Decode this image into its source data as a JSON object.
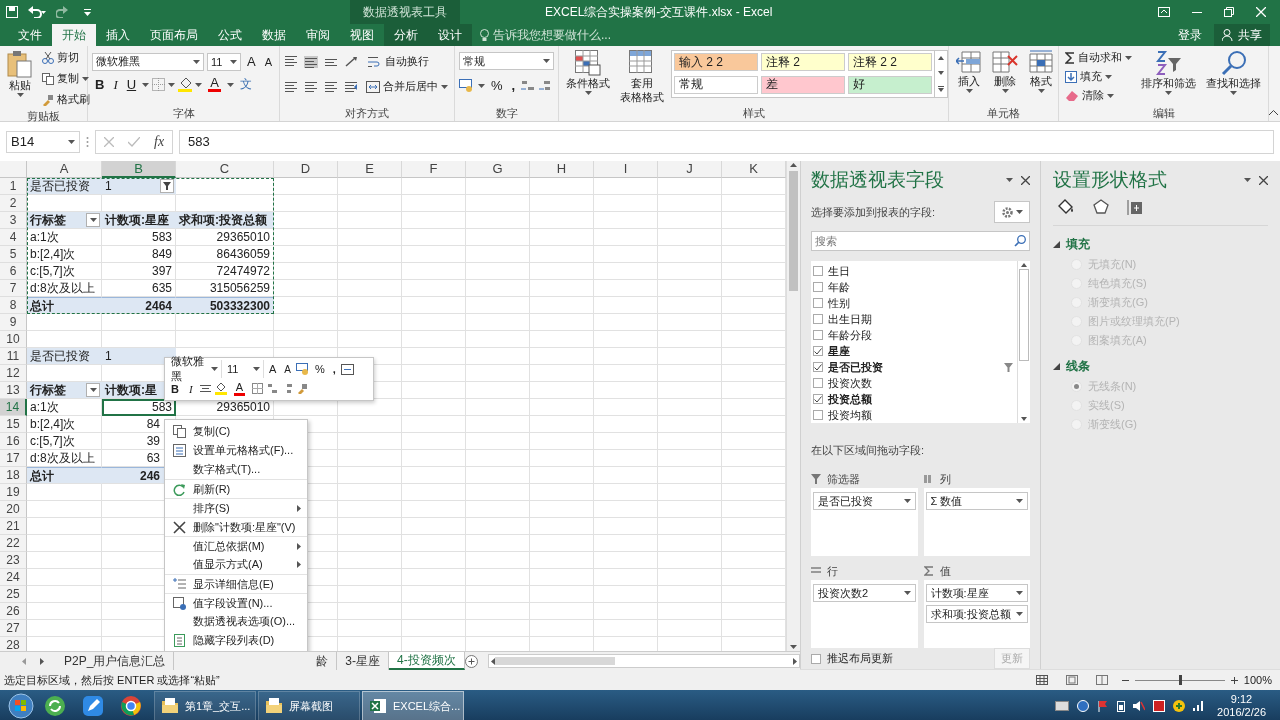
{
  "title_bar": {
    "title": "EXCEL综合实操案例-交互课件.xlsx - Excel",
    "context_group": "数据透视表工具"
  },
  "tabs": [
    {
      "label": "文件",
      "selected": false,
      "contextual": false
    },
    {
      "label": "开始",
      "selected": true,
      "contextual": false
    },
    {
      "label": "插入",
      "selected": false,
      "contextual": false
    },
    {
      "label": "页面布局",
      "selected": false,
      "contextual": false
    },
    {
      "label": "公式",
      "selected": false,
      "contextual": false
    },
    {
      "label": "数据",
      "selected": false,
      "contextual": false
    },
    {
      "label": "审阅",
      "selected": false,
      "contextual": false
    },
    {
      "label": "视图",
      "selected": false,
      "contextual": false
    },
    {
      "label": "分析",
      "selected": false,
      "contextual": true
    },
    {
      "label": "设计",
      "selected": false,
      "contextual": true
    }
  ],
  "tell_me": {
    "placeholder": "告诉我您想要做什么..."
  },
  "account": {
    "sign_in": "登录",
    "share": "共享"
  },
  "ribbon": {
    "clipboard": {
      "paste": "粘贴",
      "cut": "剪切",
      "copy": "复制",
      "format_painter": "格式刷",
      "label": "剪贴板"
    },
    "font": {
      "name": "微软雅黑",
      "size": "11",
      "grow": "A",
      "shrink": "A",
      "bold": "B",
      "italic": "I",
      "underline": "U",
      "font_color_glyph": "A",
      "phonetic": "文",
      "label": "字体"
    },
    "alignment": {
      "wrap": "自动换行",
      "merge": "合并后居中",
      "label": "对齐方式"
    },
    "number": {
      "format": "常规",
      "percent": "%",
      "comma": ",",
      "label": "数字"
    },
    "styles": {
      "conditional": "条件格式",
      "table_lines": [
        "套用",
        "表格格式"
      ],
      "label": "样式",
      "gallery": [
        {
          "label": "输入 2 2",
          "color": "#f9c89b"
        },
        {
          "label": "注释 2",
          "color": "#ffffcc"
        },
        {
          "label": "注释 2 2",
          "color": "#ffffcc"
        },
        {
          "label": "常规",
          "color": "#ffffff"
        },
        {
          "label": "差",
          "color": "#ffc7ce"
        },
        {
          "label": "好",
          "color": "#c6efce"
        }
      ]
    },
    "cells": {
      "insert": "插入",
      "delete": "删除",
      "format": "格式",
      "label": "单元格"
    },
    "editing": {
      "autosum": "自动求和",
      "fill": "填充",
      "clear": "清除",
      "sort": "排序和筛选",
      "find": "查找和选择",
      "label": "编辑"
    }
  },
  "formula_bar": {
    "name_box": "B14",
    "function_label": "fx",
    "value": "583"
  },
  "grid": {
    "columns": [
      {
        "label": "A",
        "selected": false
      },
      {
        "label": "B",
        "selected": true
      },
      {
        "label": "C",
        "selected": false
      },
      {
        "label": "D",
        "selected": false
      },
      {
        "label": "E",
        "selected": false
      },
      {
        "label": "F",
        "selected": false
      },
      {
        "label": "G",
        "selected": false
      },
      {
        "label": "H",
        "selected": false
      },
      {
        "label": "I",
        "selected": false
      },
      {
        "label": "J",
        "selected": false
      },
      {
        "label": "K",
        "selected": false
      }
    ],
    "rows": [
      {
        "number": "1",
        "selected": false,
        "kind": "filter",
        "covered": false,
        "cells": [
          "是否已投资",
          "1"
        ]
      },
      {
        "number": "2",
        "selected": false,
        "kind": "empty",
        "cells": []
      },
      {
        "number": "3",
        "selected": false,
        "kind": "header",
        "cells": [
          "行标签",
          "计数项:星座",
          "求和项:投资总额"
        ]
      },
      {
        "number": "4",
        "selected": false,
        "kind": "data",
        "covered": false,
        "cells": [
          "a:1次",
          "583",
          "29365010"
        ]
      },
      {
        "number": "5",
        "selected": false,
        "kind": "data",
        "covered": false,
        "cells": [
          "b:[2,4]次",
          "849",
          "86436059"
        ]
      },
      {
        "number": "6",
        "selected": false,
        "kind": "data",
        "covered": false,
        "cells": [
          "c:[5,7]次",
          "397",
          "72474972"
        ]
      },
      {
        "number": "7",
        "selected": false,
        "kind": "data",
        "covered": false,
        "cells": [
          "d:8次及以上",
          "635",
          "315056259"
        ]
      },
      {
        "number": "8",
        "selected": false,
        "kind": "total",
        "covered": false,
        "cells": [
          "总计",
          "2464",
          "503332300"
        ]
      },
      {
        "number": "9",
        "selected": false,
        "kind": "empty",
        "cells": []
      },
      {
        "number": "10",
        "selected": false,
        "kind": "empty",
        "cells": []
      },
      {
        "number": "11",
        "selected": false,
        "kind": "filter",
        "covered": true,
        "cells": [
          "是否已投资",
          "1"
        ]
      },
      {
        "number": "12",
        "selected": false,
        "kind": "empty",
        "cells": []
      },
      {
        "number": "13",
        "selected": false,
        "kind": "header",
        "cells": [
          "行标签",
          "计数项:星"
        ]
      },
      {
        "number": "14",
        "selected": true,
        "kind": "data",
        "covered": false,
        "cells": [
          "a:1次",
          "583",
          "29365010"
        ]
      },
      {
        "number": "15",
        "selected": false,
        "kind": "data",
        "covered": true,
        "cells": [
          "b:[2,4]次",
          "84"
        ]
      },
      {
        "number": "16",
        "selected": false,
        "kind": "data",
        "covered": true,
        "cells": [
          "c:[5,7]次",
          "39"
        ]
      },
      {
        "number": "17",
        "selected": false,
        "kind": "data",
        "covered": true,
        "cells": [
          "d:8次及以上",
          "63"
        ]
      },
      {
        "number": "18",
        "selected": false,
        "kind": "total",
        "covered": true,
        "cells": [
          "总计",
          "246"
        ]
      },
      {
        "number": "19",
        "selected": false,
        "kind": "empty",
        "cells": []
      },
      {
        "number": "20",
        "selected": false,
        "kind": "empty",
        "cells": []
      },
      {
        "number": "21",
        "selected": false,
        "kind": "empty",
        "cells": []
      },
      {
        "number": "22",
        "selected": false,
        "kind": "empty",
        "cells": []
      },
      {
        "number": "23",
        "selected": false,
        "kind": "empty",
        "cells": []
      },
      {
        "number": "24",
        "selected": false,
        "kind": "empty",
        "cells": []
      },
      {
        "number": "25",
        "selected": false,
        "kind": "empty",
        "cells": []
      },
      {
        "number": "26",
        "selected": false,
        "kind": "empty",
        "cells": []
      },
      {
        "number": "27",
        "selected": false,
        "kind": "empty",
        "cells": []
      },
      {
        "number": "28",
        "selected": false,
        "kind": "empty",
        "cells": []
      }
    ]
  },
  "mini_toolbar": {
    "font": "微软雅黑",
    "size": "11",
    "grow": "A",
    "shrink": "A",
    "percent": "%",
    "comma": ",",
    "bold": "B",
    "italic": "I",
    "font_color_glyph": "A"
  },
  "context_menu": [
    {
      "label": "复制(C)",
      "kind": "copy",
      "divider": false
    },
    {
      "label": "设置单元格格式(F)...",
      "kind": "format",
      "divider": false
    },
    {
      "label": "数字格式(T)...",
      "kind": "plain",
      "divider": false
    },
    {
      "label": "刷新(R)",
      "kind": "refresh",
      "divider": true
    },
    {
      "label": "排序(S)",
      "kind": "submenu",
      "divider": true
    },
    {
      "label": "删除\"计数项:星座\"(V)",
      "kind": "delete",
      "divider": true
    },
    {
      "label": "值汇总依据(M)",
      "kind": "submenu",
      "divider": true
    },
    {
      "label": "值显示方式(A)",
      "kind": "submenu",
      "divider": false
    },
    {
      "label": "显示详细信息(E)",
      "kind": "detail",
      "divider": true
    },
    {
      "label": "值字段设置(N)...",
      "kind": "settings",
      "divider": true
    },
    {
      "label": "数据透视表选项(O)...",
      "kind": "plain",
      "divider": false
    },
    {
      "label": "隐藏字段列表(D)",
      "kind": "list",
      "divider": false
    }
  ],
  "sheet_tabs": [
    {
      "label": "P2P_用户信息汇总",
      "selected": false,
      "kind": "full"
    },
    {
      "label": "龄",
      "selected": false,
      "kind": "partial"
    },
    {
      "label": "3-星座",
      "selected": false,
      "kind": "full"
    },
    {
      "label": "4-投资频次",
      "selected": true,
      "kind": "full"
    }
  ],
  "pivot_pane": {
    "title": "数据透视表字段",
    "subtitle": "选择要添加到报表的字段:",
    "search": {
      "placeholder": "搜索"
    },
    "fields": [
      {
        "label": "生日",
        "checked": false,
        "filtered": false
      },
      {
        "label": "年龄",
        "checked": false,
        "filtered": false
      },
      {
        "label": "性别",
        "checked": false,
        "filtered": false
      },
      {
        "label": "出生日期",
        "checked": false,
        "filtered": false
      },
      {
        "label": "年龄分段",
        "checked": false,
        "filtered": false
      },
      {
        "label": "星座",
        "checked": true,
        "filtered": false
      },
      {
        "label": "是否已投资",
        "checked": true,
        "filtered": true
      },
      {
        "label": "投资次数",
        "checked": false,
        "filtered": false
      },
      {
        "label": "投资总额",
        "checked": true,
        "filtered": false
      },
      {
        "label": "投资均额",
        "checked": false,
        "filtered": false
      }
    ],
    "areas_label": "在以下区域间拖动字段:",
    "areas": [
      {
        "title": "筛选器",
        "kind": "filter",
        "items": [
          "是否已投资"
        ]
      },
      {
        "title": "列",
        "kind": "columns",
        "items": [
          "Σ 数值"
        ]
      },
      {
        "title": "行",
        "kind": "rows",
        "items": [
          "投资次数2"
        ]
      },
      {
        "title": "值",
        "kind": "values",
        "items": [
          "计数项:星座",
          "求和项:投资总额"
        ]
      }
    ],
    "defer": {
      "label": "推迟布局更新",
      "checked": false
    },
    "update_button": {
      "label": "更新",
      "disabled": true
    }
  },
  "shape_pane": {
    "title": "设置形状格式",
    "disabled": true,
    "sections": [
      {
        "title": "填充",
        "expanded": true,
        "options": [
          {
            "label": "无填充(N)",
            "selected": false
          },
          {
            "label": "纯色填充(S)",
            "selected": false
          },
          {
            "label": "渐变填充(G)",
            "selected": false
          },
          {
            "label": "图片或纹理填充(P)",
            "selected": false
          },
          {
            "label": "图案填充(A)",
            "selected": false
          }
        ]
      },
      {
        "title": "线条",
        "expanded": true,
        "options": [
          {
            "label": "无线条(N)",
            "selected": true
          },
          {
            "label": "实线(S)",
            "selected": false
          },
          {
            "label": "渐变线(G)",
            "selected": false
          }
        ]
      }
    ]
  },
  "status_bar": {
    "message": "选定目标区域，然后按 ENTER 或选择“粘贴”",
    "zoom": {
      "level": 0.5,
      "label": "100%"
    }
  },
  "taskbar": {
    "tasks": [
      {
        "label": "第1章_交互...",
        "kind": "folder",
        "selected": false
      },
      {
        "label": "屏幕截图",
        "kind": "folder",
        "selected": false
      },
      {
        "label": "EXCEL综合...",
        "kind": "excel",
        "selected": true
      }
    ],
    "time": "9:12",
    "date": "2016/2/26"
  }
}
